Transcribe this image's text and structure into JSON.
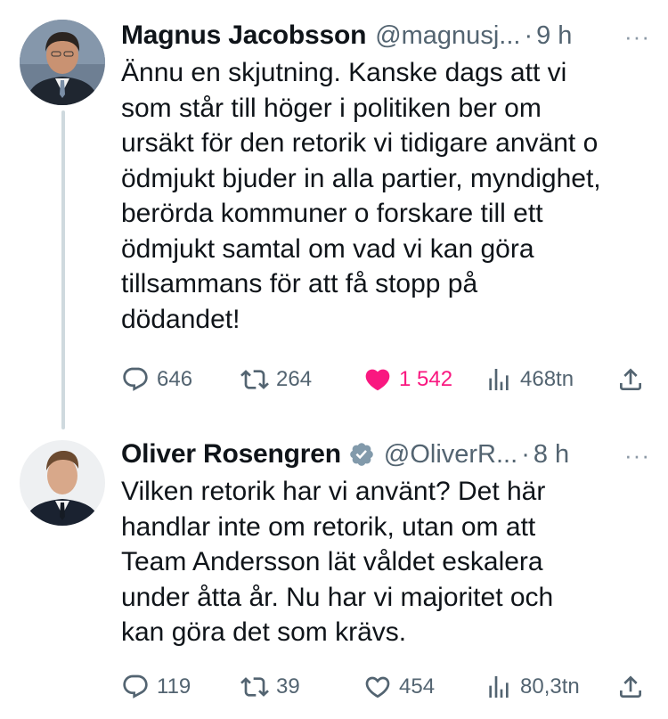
{
  "tweets": [
    {
      "name": "Magnus Jacobsson",
      "handle": "@magnusj...",
      "separator": "·",
      "time": "9 h",
      "more": "···",
      "text": "Ännu en skjutning. Kanske dags att vi\nsom står till höger i politiken ber om\nursäkt för den retorik vi tidigare använt o\nödmjukt bjuder in alla partier, myndighet,\nberörda kommuner o forskare till ett\nödmjukt samtal om vad vi kan göra\ntillsammans för att få stopp på\ndödandet!",
      "replies": "646",
      "retweets": "264",
      "likes": "1 542",
      "liked": true,
      "views": "468tn",
      "verified": false
    },
    {
      "name": "Oliver Rosengren",
      "handle": "@OliverR...",
      "separator": "·",
      "time": "8 h",
      "more": "···",
      "text": "Vilken retorik har vi använt? Det här\nhandlar inte om retorik, utan om att\nTeam Andersson lät våldet eskalera\nunder åtta år. Nu har vi majoritet och\nkan göra det som krävs.",
      "replies": "119",
      "retweets": "39",
      "likes": "454",
      "liked": false,
      "views": "80,3tn",
      "verified": true
    }
  ],
  "colors": {
    "text": "#0f1419",
    "secondary": "#536471",
    "like_active": "#f91880",
    "thread_line": "#cfd9de",
    "verified_badge": "#829aab"
  },
  "icons": [
    "reply-icon",
    "retweet-icon",
    "like-icon",
    "views-icon",
    "share-icon",
    "verified-badge-icon",
    "more-icon"
  ]
}
